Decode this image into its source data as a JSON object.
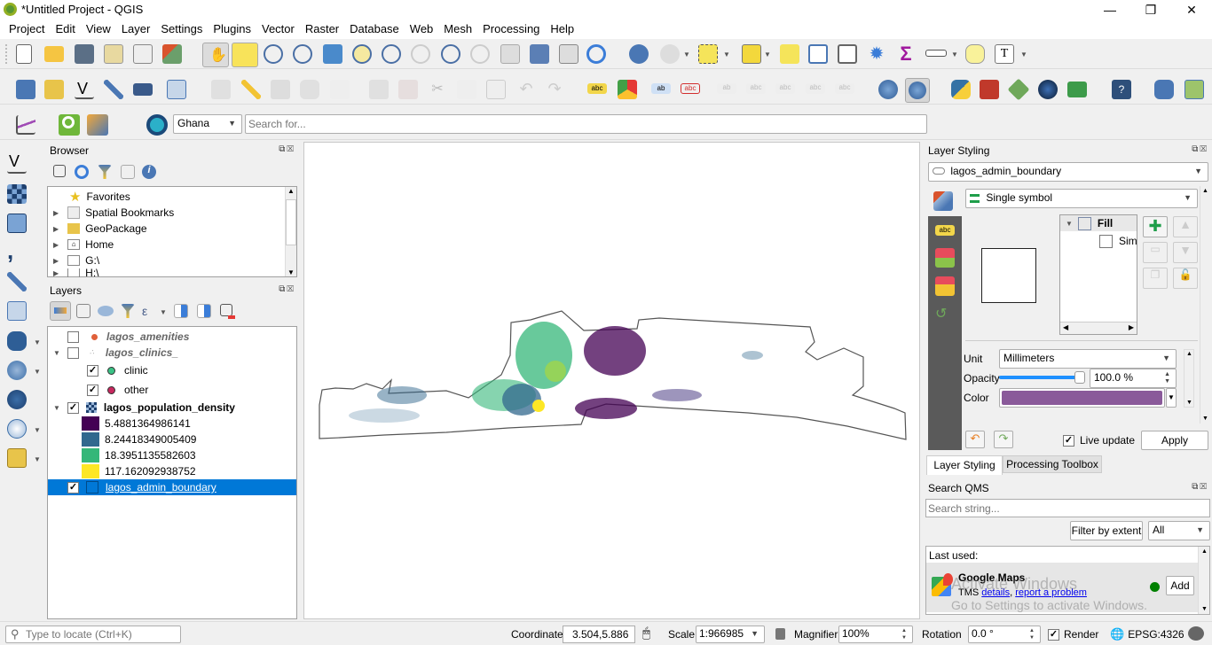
{
  "window": {
    "title": "*Untitled Project - QGIS",
    "minimize": "—",
    "maximize": "❐",
    "close": "✕"
  },
  "menu": [
    "Project",
    "Edit",
    "View",
    "Layer",
    "Settings",
    "Plugins",
    "Vector",
    "Raster",
    "Database",
    "Web",
    "Mesh",
    "Processing",
    "Help"
  ],
  "toolbar3": {
    "geocoder_country": "Ghana",
    "search_placeholder": "Search for..."
  },
  "browser": {
    "title": "Browser",
    "items": [
      {
        "label": "Favorites",
        "icon": "star-icon",
        "expandable": false
      },
      {
        "label": "Spatial Bookmarks",
        "icon": "bookmark-icon",
        "expandable": true
      },
      {
        "label": "GeoPackage",
        "icon": "geopackage-icon",
        "expandable": true
      },
      {
        "label": "Home",
        "icon": "home-folder-icon",
        "expandable": true
      },
      {
        "label": "G:\\",
        "icon": "folder-icon",
        "expandable": true
      },
      {
        "label": "H:\\",
        "icon": "folder-icon",
        "expandable": true
      }
    ]
  },
  "layers": {
    "title": "Layers",
    "items": [
      {
        "label": "lagos_amenities",
        "checked": false,
        "italic": true,
        "symbol_color": "#e0603a"
      },
      {
        "label": "lagos_clinics_",
        "checked": false,
        "italic": true,
        "expanded": true
      },
      {
        "label": "clinic",
        "checked": true,
        "symbol_color": "#3ac285"
      },
      {
        "label": "other",
        "checked": true,
        "symbol_color": "#c8285f"
      },
      {
        "label": "lagos_population_density",
        "checked": true,
        "bold": true,
        "expanded": true
      },
      {
        "label": "5.4881364986141",
        "color": "#440154"
      },
      {
        "label": "8.24418349005409",
        "color": "#31688e"
      },
      {
        "label": "18.3951135582603",
        "color": "#35b779"
      },
      {
        "label": "117.162092938752",
        "color": "#fde725"
      },
      {
        "label": "lagos_admin_boundary",
        "checked": true,
        "selected": true
      }
    ]
  },
  "layer_styling": {
    "title": "Layer Styling",
    "layer": "lagos_admin_boundary",
    "renderer": "Single symbol",
    "symbol_tree": [
      "Fill",
      "Sim"
    ],
    "unit_label": "Unit",
    "unit": "Millimeters",
    "opacity_label": "Opacity",
    "opacity": "100.0 %",
    "opacity_fraction": 1.0,
    "color_label": "Color",
    "color": "#8a5a9a",
    "live_update_label": "Live update",
    "live_update": true,
    "apply": "Apply",
    "tabs": [
      "Layer Styling",
      "Processing Toolbox"
    ]
  },
  "qms": {
    "title": "Search QMS",
    "search_placeholder": "Search string...",
    "filter_button": "Filter by extent",
    "filter_value": "All",
    "last_used": "Last used:",
    "service_name": "Google Maps",
    "service_type": "TMS",
    "details_link": "details",
    "report_link": "report a problem",
    "add_button": "Add",
    "status_color": "#008000"
  },
  "watermark": {
    "line1": "Activate Windows",
    "line2": "Go to Settings to activate Windows."
  },
  "statusbar": {
    "locator_placeholder": "Type to locate (Ctrl+K)",
    "coordinate_label": "Coordinate",
    "coordinate": "3.504,5.886",
    "scale_label": "Scale",
    "scale": "1:966985",
    "magnifier_label": "Magnifier",
    "magnifier": "100%",
    "rotation_label": "Rotation",
    "rotation": "0.0 °",
    "render_label": "Render",
    "render": true,
    "crs": "EPSG:4326"
  }
}
